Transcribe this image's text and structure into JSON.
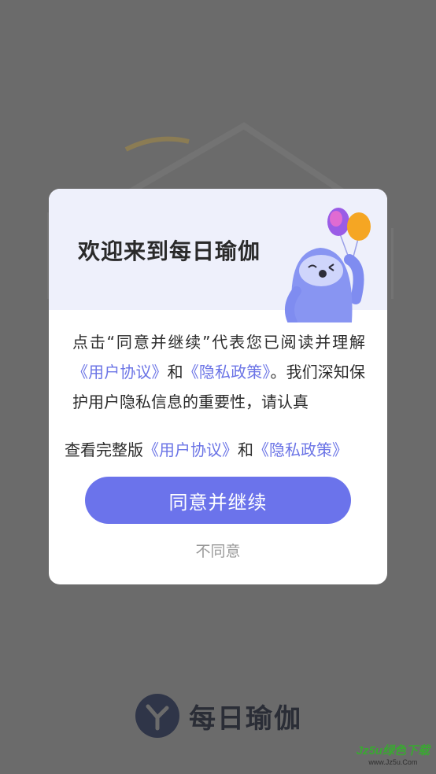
{
  "app": {
    "name": "每日瑜伽"
  },
  "modal": {
    "title": "欢迎来到每日瑜伽",
    "intro_prefix": "点击“同意并继续”代表您已阅读并理解",
    "user_agreement": "《用户协议》",
    "and": "和",
    "privacy_policy": "《隐私政策》",
    "intro_suffix": "。我们深知保护用户隐私信息的重要性，请认真",
    "view_full": "查看完整版",
    "agree_button": "同意并继续",
    "disagree_button": "不同意"
  },
  "watermark": {
    "main": "Jz5u绿色下载",
    "sub": "www.Jz5u.Com"
  },
  "colors": {
    "accent": "#6b73eb",
    "link": "#6b74e6",
    "overlay": "#6b6b6b"
  }
}
